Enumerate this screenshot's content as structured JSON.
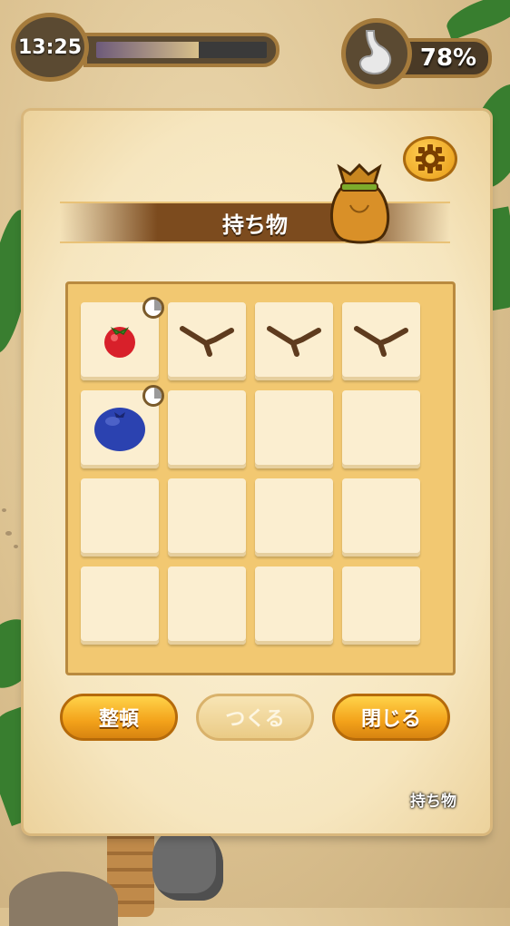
{
  "hud": {
    "time": "13:25",
    "time_progress": 0.6,
    "hunger_percent": "78%"
  },
  "panel": {
    "title": "持ち物"
  },
  "inventory": {
    "slots": [
      {
        "item": "tomato-icon",
        "fresh_indicator": true
      },
      {
        "item": "stick-icon",
        "fresh_indicator": false
      },
      {
        "item": "stick-icon",
        "fresh_indicator": false
      },
      {
        "item": "stick-icon",
        "fresh_indicator": false
      },
      {
        "item": "blueberry-icon",
        "fresh_indicator": true
      },
      {
        "item": "",
        "fresh_indicator": false
      },
      {
        "item": "",
        "fresh_indicator": false
      },
      {
        "item": "",
        "fresh_indicator": false
      },
      {
        "item": "",
        "fresh_indicator": false
      },
      {
        "item": "",
        "fresh_indicator": false
      },
      {
        "item": "",
        "fresh_indicator": false
      },
      {
        "item": "",
        "fresh_indicator": false
      },
      {
        "item": "",
        "fresh_indicator": false
      },
      {
        "item": "",
        "fresh_indicator": false
      },
      {
        "item": "",
        "fresh_indicator": false
      },
      {
        "item": "",
        "fresh_indicator": false
      }
    ]
  },
  "buttons": {
    "sort_label": "整頓",
    "craft_label": "つくる",
    "close_label": "閉じる"
  },
  "footer": {
    "label": "持ち物"
  },
  "colors": {
    "accent": "#f3a21a",
    "panel": "#f6e6bf",
    "title_band": "#7c4b1e"
  }
}
